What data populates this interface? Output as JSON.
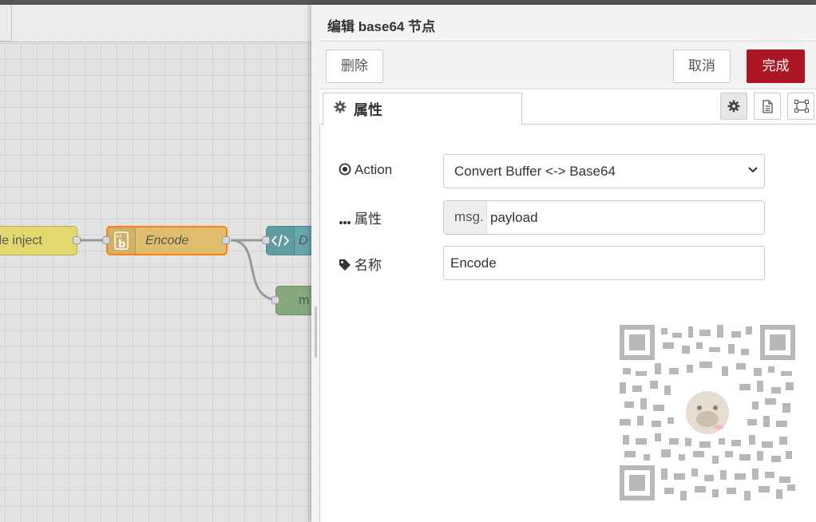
{
  "workspace": {
    "nodes": {
      "inject_label": "ile inject",
      "encode_label": "Encode",
      "json_label": "D",
      "debug_label": "m"
    }
  },
  "tray": {
    "title": "编辑 base64 节点",
    "toolbar": {
      "delete_label": "删除",
      "cancel_label": "取消",
      "done_label": "完成"
    },
    "tabs": {
      "properties_label": "属性"
    },
    "icons": [
      "gear-icon",
      "document-icon",
      "frame-icon"
    ],
    "form": {
      "action": {
        "label": "Action",
        "selected": "Convert Buffer <-> Base64"
      },
      "property": {
        "label": "属性",
        "prefix": "msg.",
        "value": "payload"
      },
      "name": {
        "label": "名称",
        "value": "Encode"
      }
    }
  },
  "colors": {
    "accent": "#ad1625",
    "selection": "#ff7f0e",
    "inject_node": "#e2d96e",
    "encode_node": "#dfbd6f",
    "json_node": "#67a6ab",
    "debug_node": "#87a980"
  }
}
